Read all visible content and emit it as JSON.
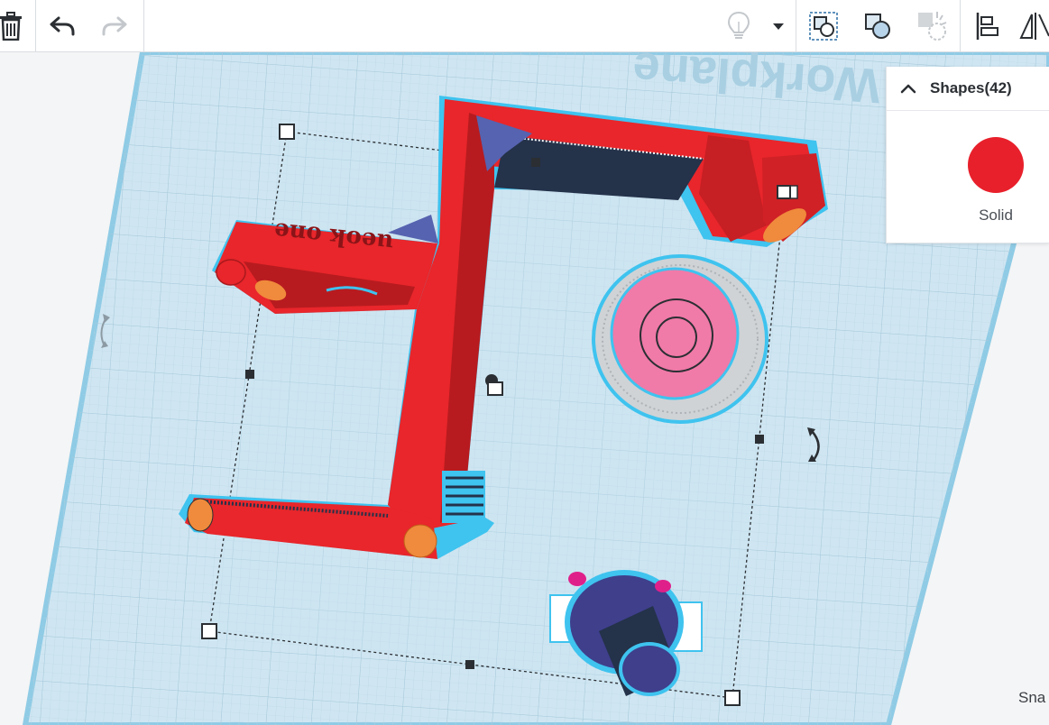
{
  "toolbar": {
    "icons": [
      "trash-icon",
      "undo-icon",
      "redo-icon",
      "lightbulb-icon",
      "chevron-down-icon",
      "group-icon",
      "ungroup-icon",
      "hole-icon",
      "align-icon",
      "mirror-icon"
    ]
  },
  "workplane": {
    "label": "Workplane",
    "colors": {
      "grid_bg": "#cfe6f2",
      "grid_line": "#b9d4e3",
      "edge": "#8fcbe5"
    }
  },
  "model": {
    "engraved_text": "ueok one",
    "colors": {
      "body": "#e8262b",
      "body_dark": "#b71b1f",
      "highlight": "#3fc3ef",
      "cylinder": "#f08a3c",
      "pink": "#f07aa8",
      "navy": "#3f3f8c",
      "gray_ring": "#cfd3d6"
    }
  },
  "shapes_panel": {
    "title": "Shapes(42)",
    "solid_label": "Solid",
    "solid_color": "#e8202b"
  },
  "status": {
    "snap_label": "Sna"
  }
}
